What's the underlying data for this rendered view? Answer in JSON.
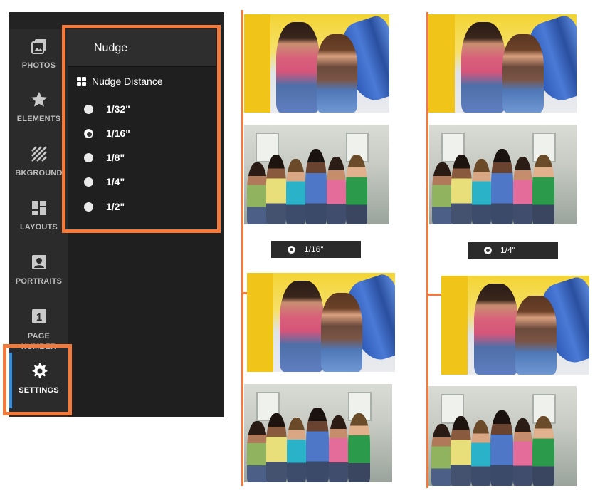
{
  "sidebar": {
    "items": [
      {
        "label": "PHOTOS",
        "icon": "photos-icon"
      },
      {
        "label": "ELEMENTS",
        "icon": "star-icon"
      },
      {
        "label": "BKGROUND",
        "icon": "background-hatch-icon"
      },
      {
        "label": "LAYOUTS",
        "icon": "layouts-grid-icon"
      },
      {
        "label": "PORTRAITS",
        "icon": "portrait-icon"
      },
      {
        "label": "PAGE\nNUMBER",
        "icon": "page-number-icon",
        "icon_text": "1"
      },
      {
        "label": "SETTINGS",
        "icon": "gear-icon",
        "active": true
      }
    ]
  },
  "panel": {
    "title": "Nudge",
    "section_title": "Nudge Distance",
    "section_icon": "grid-icon",
    "options": [
      {
        "label": "1/32\"",
        "checked": false
      },
      {
        "label": "1/16\"",
        "checked": true
      },
      {
        "label": "1/8\"",
        "checked": false
      },
      {
        "label": "1/4\"",
        "checked": false
      },
      {
        "label": "1/2\"",
        "checked": false
      }
    ]
  },
  "comparison": {
    "left": {
      "badge": "1/16\""
    },
    "right": {
      "badge": "1/4\""
    }
  },
  "colors": {
    "highlight": "#f47a3c",
    "rail_bg": "#2b2b2b",
    "panel_bg": "#1f1f1f",
    "active_indicator": "#2f8fe8"
  }
}
